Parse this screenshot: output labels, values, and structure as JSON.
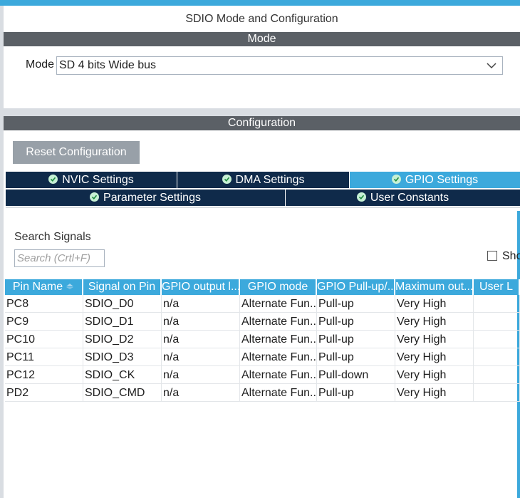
{
  "window": {
    "title": "SDIO Mode and Configuration"
  },
  "mode_section": {
    "header": "Mode",
    "label": "Mode",
    "selected": "SD 4 bits Wide bus"
  },
  "config_section": {
    "header": "Configuration",
    "reset_label": "Reset Configuration",
    "tabs": [
      {
        "label": "NVIC Settings",
        "active": false
      },
      {
        "label": "DMA Settings",
        "active": false
      },
      {
        "label": "GPIO Settings",
        "active": true
      },
      {
        "label": "Parameter Settings",
        "active": false
      },
      {
        "label": "User Constants",
        "active": false
      }
    ]
  },
  "search": {
    "label": "Search Signals",
    "placeholder": "Search (Crtl+F)",
    "checkbox_label": "Sho"
  },
  "table": {
    "columns": [
      "Pin Name",
      "Signal on Pin",
      "GPIO output l...",
      "GPIO mode",
      "GPIO Pull-up/...",
      "Maximum out...",
      "User L"
    ],
    "rows": [
      [
        "PC8",
        "SDIO_D0",
        "n/a",
        "Alternate Fun...",
        "Pull-up",
        "Very High",
        ""
      ],
      [
        "PC9",
        "SDIO_D1",
        "n/a",
        "Alternate Fun...",
        "Pull-up",
        "Very High",
        ""
      ],
      [
        "PC10",
        "SDIO_D2",
        "n/a",
        "Alternate Fun...",
        "Pull-up",
        "Very High",
        ""
      ],
      [
        "PC11",
        "SDIO_D3",
        "n/a",
        "Alternate Fun...",
        "Pull-up",
        "Very High",
        ""
      ],
      [
        "PC12",
        "SDIO_CK",
        "n/a",
        "Alternate Fun...",
        "Pull-down",
        "Very High",
        ""
      ],
      [
        "PD2",
        "SDIO_CMD",
        "n/a",
        "Alternate Fun...",
        "Pull-up",
        "Very High",
        ""
      ]
    ]
  },
  "colors": {
    "accent": "#3ca9dc",
    "section_header": "#5b6066",
    "tab_dark": "#0f2a4a",
    "button_grey": "#98a0a8"
  }
}
